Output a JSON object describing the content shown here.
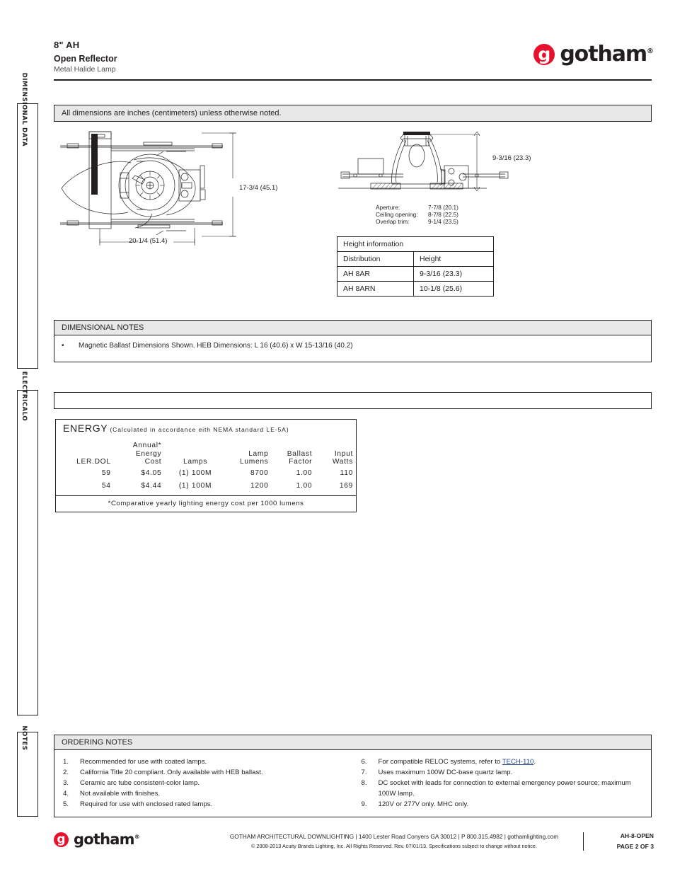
{
  "brand": {
    "name": "gotham",
    "registered": "®",
    "mark_letter": "g",
    "accent_color": "#e8112d"
  },
  "header": {
    "title": "8\" AH",
    "subtitle": "Open Reflector",
    "description": "Metal Halide Lamp"
  },
  "side_tabs": [
    {
      "label": "DIMENSIONAL DATA"
    },
    {
      "label": "ELECTRICALO"
    },
    {
      "label": "NOTES"
    }
  ],
  "dimensional": {
    "banner": "All dimensions are inches (centimeters) unless otherwise noted.",
    "plan_view": {
      "height_dim": "17-3/4 (45.1)",
      "width_dim": "20-1/4 (51.4)"
    },
    "section_view": {
      "height_dim": "9-3/16 (23.3)"
    },
    "aperture_specs": [
      {
        "label": "Aperture:",
        "value": "7-7/8 (20.1)"
      },
      {
        "label": "Ceiling opening:",
        "value": "8-7/8 (22.5)"
      },
      {
        "label": "Overlap trim:",
        "value": "9-1/4 (23.5)"
      }
    ],
    "height_table": {
      "caption": "Height information",
      "columns": [
        "Distribution",
        "Height"
      ],
      "rows": [
        [
          "AH 8AR",
          "9-3/16 (23.3)"
        ],
        [
          "AH 8ARN",
          "10-1/8 (25.6)"
        ]
      ]
    },
    "notes": {
      "title": "DIMENSIONAL NOTES",
      "items": [
        {
          "bullet": "•",
          "text": "Magnetic Ballast Dimensions Shown. HEB Dimensions: L 16 (40.6) x W 15-13/16 (40.2)"
        }
      ]
    }
  },
  "electrical": {
    "energy": {
      "title": "ENERGY",
      "subtitle": "(Calculated in accordance eith NEMA standard  LE-5A)",
      "columns": [
        "LER.DOL",
        "Annual*\nEnergy\nCost",
        "Lamps",
        "Lamp\nLumens",
        "Ballast\nFactor",
        "Input\nWatts"
      ],
      "rows": [
        {
          "ler_dol": "59",
          "annual_energy_cost": "$4.05",
          "lamps": "(1)  100M",
          "lamp_lumens": "8700",
          "ballast_factor": "1.00",
          "input_watts": "110"
        },
        {
          "ler_dol": "54",
          "annual_energy_cost": "$4.44",
          "lamps": "(1)  100M",
          "lamp_lumens": "1200",
          "ballast_factor": "1.00",
          "input_watts": "169"
        }
      ],
      "footnote": "*Comparative yearly lighting energy cost per 1000 lumens"
    }
  },
  "ordering_notes": {
    "title": "ORDERING NOTES",
    "left": [
      {
        "num": "1.",
        "text": "Recommended for use with coated lamps."
      },
      {
        "num": "2.",
        "text": "California Title 20 compliant. Only available with HEB ballast."
      },
      {
        "num": "3.",
        "text": "Ceramic arc tube consistent-color lamp."
      },
      {
        "num": "4.",
        "text": "Not available with finishes."
      },
      {
        "num": "5.",
        "text": "Required for use with enclosed rated lamps."
      }
    ],
    "right": [
      {
        "num": "6.",
        "text_before": "For compatible RELOC systems, refer to ",
        "link": "TECH-110",
        "text_after": "."
      },
      {
        "num": "7.",
        "text": "Uses maximum 100W DC-base quartz lamp."
      },
      {
        "num": "8.",
        "text": "DC socket with leads for connection to external emergency power source; maximum 100W lamp."
      },
      {
        "num": "9.",
        "text": "120V or 277V only. MHC only."
      }
    ]
  },
  "footer": {
    "line1": "GOTHAM ARCHITECTURAL DOWNLIGHTING  |  1400 Lester Road Conyers GA 30012  |  P 800.315.4982  |  gothamlighting.com",
    "line2": "© 2008-2013 Acuity Brands Lighting, Inc. All Rights Reserved. Rev. 07/01/13. Specifications subject to change without notice.",
    "doc_code": "AH-8-OPEN",
    "page": "PAGE 2 OF 3"
  }
}
